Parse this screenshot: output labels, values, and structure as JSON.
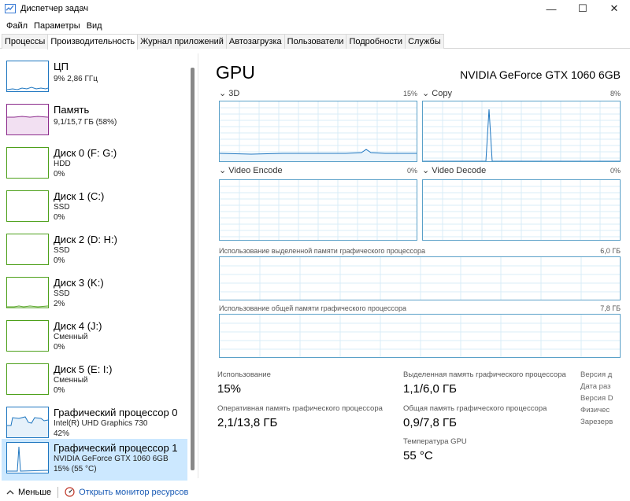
{
  "window": {
    "title": "Диспетчер задач",
    "min": "—",
    "max": "☐",
    "close": "✕"
  },
  "menu": [
    "Файл",
    "Параметры",
    "Вид"
  ],
  "tabs": [
    "Процессы",
    "Производительность",
    "Журнал приложений",
    "Автозагрузка",
    "Пользователи",
    "Подробности",
    "Службы"
  ],
  "active_tab": 1,
  "sidebar": {
    "items": [
      {
        "title": "ЦП",
        "line1": "9% 2,86 ГГц",
        "line2": "",
        "color": "#1e76c0"
      },
      {
        "title": "Память",
        "line1": "9,1/15,7 ГБ (58%)",
        "line2": "",
        "color": "#8b2a8b"
      },
      {
        "title": "Диск 0 (F: G:)",
        "line1": "HDD",
        "line2": "0%",
        "color": "#4da01a"
      },
      {
        "title": "Диск 1 (C:)",
        "line1": "SSD",
        "line2": "0%",
        "color": "#4da01a"
      },
      {
        "title": "Диск 2 (D: H:)",
        "line1": "SSD",
        "line2": "0%",
        "color": "#4da01a"
      },
      {
        "title": "Диск 3 (K:)",
        "line1": "SSD",
        "line2": "2%",
        "color": "#4da01a"
      },
      {
        "title": "Диск 4 (J:)",
        "line1": "Сменный",
        "line2": "0%",
        "color": "#4da01a"
      },
      {
        "title": "Диск 5 (E: I:)",
        "line1": "Сменный",
        "line2": "0%",
        "color": "#4da01a"
      },
      {
        "title": "Графический процессор 0",
        "line1": "Intel(R) UHD Graphics 730",
        "line2": "42%",
        "color": "#1e76c0"
      },
      {
        "title": "Графический процессор 1",
        "line1": "NVIDIA GeForce GTX 1060 6GB",
        "line2": "15% (55 °C)",
        "color": "#1e76c0"
      }
    ]
  },
  "main": {
    "title": "GPU",
    "model": "NVIDIA GeForce GTX 1060 6GB",
    "engines": [
      {
        "name": "3D",
        "pct": "15%"
      },
      {
        "name": "Copy",
        "pct": "8%"
      },
      {
        "name": "Video Encode",
        "pct": "0%"
      },
      {
        "name": "Video Decode",
        "pct": "0%"
      }
    ],
    "dedicated_mem_label": "Использование выделенной памяти графического процессора",
    "dedicated_mem_max": "6,0 ГБ",
    "shared_mem_label": "Использование общей памяти графического процессора",
    "shared_mem_max": "7,8 ГБ",
    "stats": {
      "usage_label": "Использование",
      "usage_value": "15%",
      "ram_label": "Оперативная память графического процессора",
      "ram_value": "2,1/13,8 ГБ",
      "dedicated_label": "Выделенная память графического процессора",
      "dedicated_value": "1,1/6,0 ГБ",
      "shared_label": "Общая память графического процессора",
      "shared_value": "0,9/7,8 ГБ",
      "temp_label": "Температура GPU",
      "temp_value": "55 °C"
    },
    "props": [
      "Версия д",
      "Дата раз",
      "Версия D",
      "Физичес",
      "Зарезерв"
    ]
  },
  "footer": {
    "fewer": "Меньше",
    "monitor": "Открыть монитор ресурсов"
  },
  "colors": {
    "graph_border": "#5aa0c8",
    "graph_grid": "#d9ecf7",
    "graph_line": "#1e76c0",
    "selected": "#cce8ff",
    "link": "#1a5bb5"
  }
}
